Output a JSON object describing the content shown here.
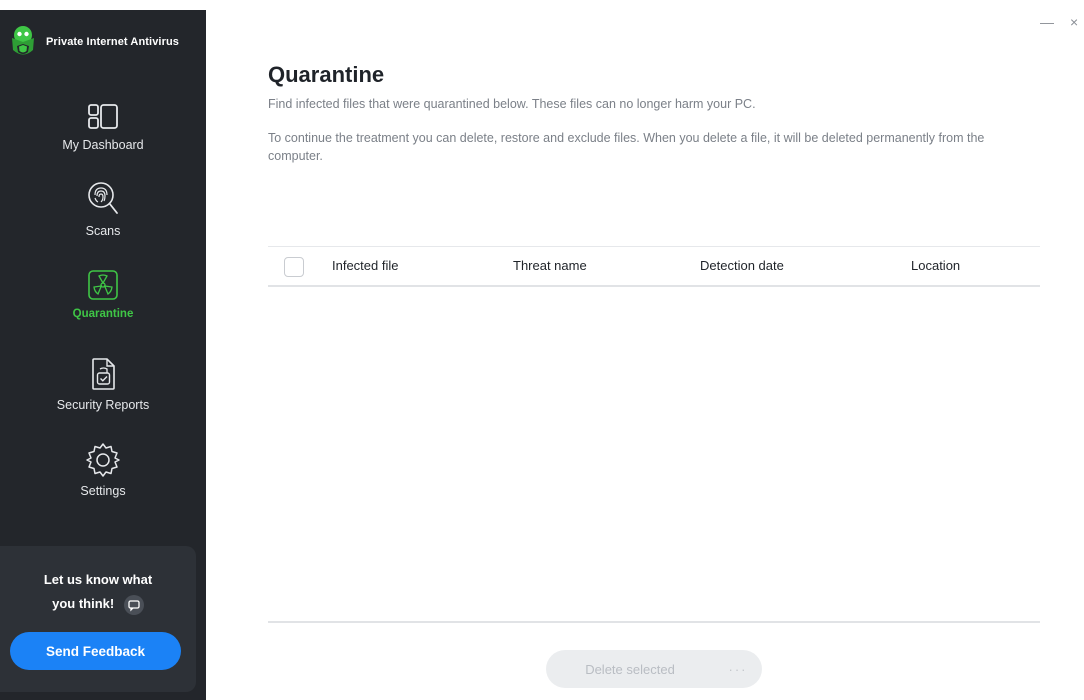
{
  "app": {
    "name": "Private Internet Antivirus"
  },
  "sidebar": {
    "items": [
      {
        "label": "My Dashboard",
        "icon": "dashboard-icon"
      },
      {
        "label": "Scans",
        "icon": "fingerprint-scan-icon"
      },
      {
        "label": "Quarantine",
        "icon": "radiation-icon",
        "active": true
      },
      {
        "label": "Security Reports",
        "icon": "report-icon"
      },
      {
        "label": "Settings",
        "icon": "gear-icon"
      }
    ],
    "feedback": {
      "line1": "Let us know what",
      "line2": "you think!",
      "button": "Send Feedback"
    }
  },
  "window": {
    "minimize": "—",
    "close": "×"
  },
  "main": {
    "title": "Quarantine",
    "description1": "Find infected files that were quarantined below. These files can no longer harm your PC.",
    "description2": "To continue the treatment you can delete, restore and exclude files. When you delete a file, it will be deleted permanently from the computer.",
    "table": {
      "columns": [
        "Infected file",
        "Threat name",
        "Detection date",
        "Location"
      ],
      "rows": []
    },
    "actions": {
      "delete_selected": "Delete selected",
      "more": "···"
    }
  },
  "colors": {
    "sidebar_bg": "#23262b",
    "accent_green": "#3fc646",
    "primary_blue": "#1b82f6"
  }
}
